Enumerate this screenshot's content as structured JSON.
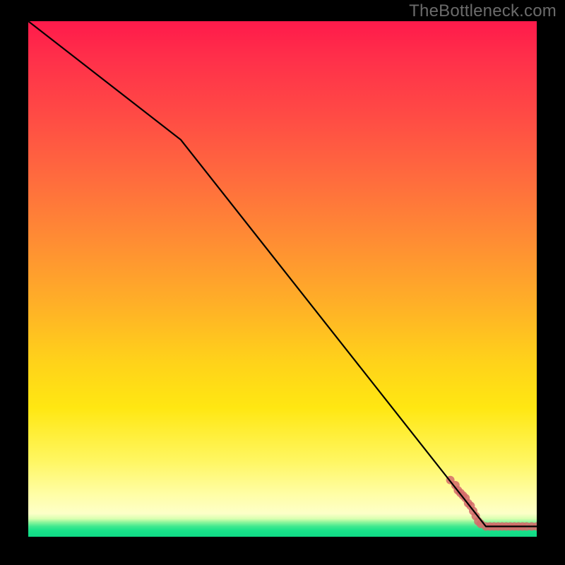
{
  "watermark": "TheBottleneck.com",
  "chart_data": {
    "type": "line",
    "title": "",
    "xlabel": "",
    "ylabel": "",
    "xlim": [
      0,
      100
    ],
    "ylim": [
      0,
      100
    ],
    "grid": false,
    "line": {
      "x": [
        0,
        30,
        90,
        100
      ],
      "y": [
        100,
        77,
        2,
        2
      ]
    },
    "scatter_series": {
      "name": "points",
      "color": "#d46a6a",
      "points": [
        {
          "x": 83,
          "y": 11
        },
        {
          "x": 84,
          "y": 10
        },
        {
          "x": 84.5,
          "y": 9
        },
        {
          "x": 85,
          "y": 8.5
        },
        {
          "x": 85.5,
          "y": 8
        },
        {
          "x": 86,
          "y": 7.5
        },
        {
          "x": 86.5,
          "y": 6.5
        },
        {
          "x": 87,
          "y": 6
        },
        {
          "x": 87.5,
          "y": 5
        },
        {
          "x": 88,
          "y": 4
        },
        {
          "x": 88.5,
          "y": 3
        },
        {
          "x": 89,
          "y": 2.5
        },
        {
          "x": 90,
          "y": 2
        },
        {
          "x": 90.8,
          "y": 2
        },
        {
          "x": 91.6,
          "y": 2
        },
        {
          "x": 92.4,
          "y": 2
        },
        {
          "x": 93.2,
          "y": 2
        },
        {
          "x": 94,
          "y": 2
        },
        {
          "x": 94.8,
          "y": 2
        },
        {
          "x": 95.6,
          "y": 2
        },
        {
          "x": 96.4,
          "y": 2
        },
        {
          "x": 97.2,
          "y": 2
        },
        {
          "x": 98,
          "y": 2
        },
        {
          "x": 99,
          "y": 2
        },
        {
          "x": 100,
          "y": 2
        }
      ]
    }
  }
}
